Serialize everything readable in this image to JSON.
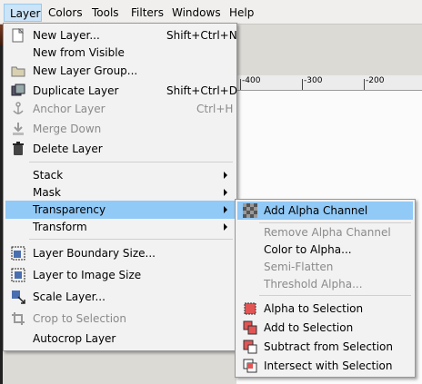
{
  "menubar": [
    {
      "label": "Layer",
      "active": true
    },
    {
      "label": "Colors"
    },
    {
      "label": "Tools"
    },
    {
      "label": "Filters"
    },
    {
      "label": "Windows"
    },
    {
      "label": "Help"
    }
  ],
  "ruler": {
    "labels": [
      "-400",
      "-300",
      "-200"
    ]
  },
  "layer_menu": {
    "new_layer": {
      "label": "New Layer...",
      "shortcut": "Shift+Ctrl+N"
    },
    "new_from_visible": {
      "label": "New from Visible"
    },
    "new_layer_group": {
      "label": "New Layer Group..."
    },
    "duplicate_layer": {
      "label": "Duplicate Layer",
      "shortcut": "Shift+Ctrl+D"
    },
    "anchor_layer": {
      "label": "Anchor Layer",
      "shortcut": "Ctrl+H"
    },
    "merge_down": {
      "label": "Merge Down"
    },
    "delete_layer": {
      "label": "Delete Layer"
    },
    "stack": {
      "label": "Stack"
    },
    "mask": {
      "label": "Mask"
    },
    "transparency": {
      "label": "Transparency"
    },
    "transform": {
      "label": "Transform"
    },
    "layer_boundary_size": {
      "label": "Layer Boundary Size..."
    },
    "layer_to_image_size": {
      "label": "Layer to Image Size"
    },
    "scale_layer": {
      "label": "Scale Layer..."
    },
    "crop_to_selection": {
      "label": "Crop to Selection"
    },
    "autocrop_layer": {
      "label": "Autocrop Layer"
    }
  },
  "transparency_menu": {
    "add_alpha_channel": {
      "label": "Add Alpha Channel"
    },
    "remove_alpha_channel": {
      "label": "Remove Alpha Channel"
    },
    "color_to_alpha": {
      "label": "Color to Alpha..."
    },
    "semi_flatten": {
      "label": "Semi-Flatten"
    },
    "threshold_alpha": {
      "label": "Threshold Alpha..."
    },
    "alpha_to_selection": {
      "label": "Alpha to Selection"
    },
    "add_to_selection": {
      "label": "Add to Selection"
    },
    "subtract_from_selection": {
      "label": "Subtract from Selection"
    },
    "intersect_with_selection": {
      "label": "Intersect with Selection"
    }
  },
  "icons": [
    "new-layer-icon",
    "new-layer-group-icon",
    "duplicate-layer-icon",
    "anchor-icon",
    "merge-down-icon",
    "delete-layer-icon",
    "layer-boundary-icon",
    "layer-to-image-icon",
    "scale-layer-icon",
    "crop-icon",
    "checkerboard-icon",
    "alpha-to-selection-icon",
    "add-to-selection-icon",
    "subtract-from-selection-icon",
    "intersect-with-selection-icon"
  ],
  "colors": {
    "highlight": "#91c9f7",
    "menu_bg": "#f2f2f2",
    "disabled_text": "#8a8a8a"
  }
}
